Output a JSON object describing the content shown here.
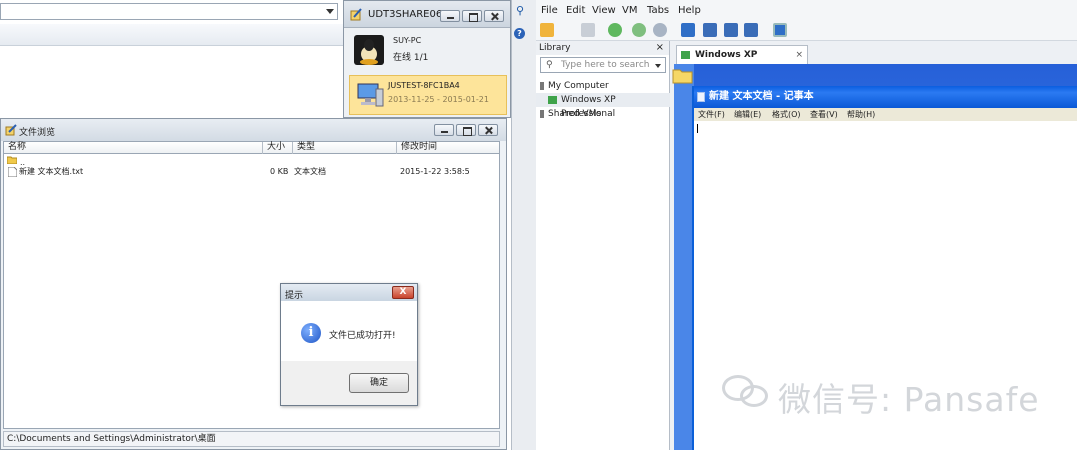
{
  "remote_panel": {
    "title": "UDT3SHARE063...",
    "hosts": [
      {
        "name": "SUY-PC",
        "status": "在线 1/1"
      },
      {
        "name": "JUSTEST-8FC1BA4",
        "status": "2013-11-25 - 2015-01-21"
      }
    ]
  },
  "file_browser": {
    "title": "文件浏览",
    "columns": [
      "名称",
      "大小",
      "类型",
      "修改时间"
    ],
    "rows": [
      {
        "name": "..",
        "size": "",
        "type": "",
        "modified": ""
      },
      {
        "name": "新建 文本文档.txt",
        "size": "0 KB",
        "type": "文本文档",
        "modified": "2015-1-22 3:58:5"
      }
    ],
    "status_path": "C:\\Documents and Settings\\Administrator\\桌面"
  },
  "dialog": {
    "title": "提示",
    "close": "X",
    "message": "文件已成功打开!",
    "ok_label": "确定",
    "icon": "info-icon"
  },
  "vmware": {
    "menu": [
      "File",
      "Edit",
      "View",
      "VM",
      "Tabs",
      "Help"
    ],
    "library": {
      "title": "Library",
      "close": "×",
      "search_placeholder": "Type here to search",
      "tree": [
        "My Computer",
        "Windows XP Professional",
        "Shared VMs"
      ]
    },
    "tab": {
      "label": "Windows XP Professional",
      "close": "×"
    },
    "notepad": {
      "title": "新建 文本文档 - 记事本",
      "menu": [
        "文件(F)",
        "编辑(E)",
        "格式(O)",
        "查看(V)",
        "帮助(H)"
      ]
    }
  },
  "watermark": {
    "text": "微信号: Pansafe"
  },
  "colors": {
    "xp_blue": "#2660d8",
    "dialog_close_red": "#c9432c",
    "highlight_yellow": "#fde49a"
  }
}
